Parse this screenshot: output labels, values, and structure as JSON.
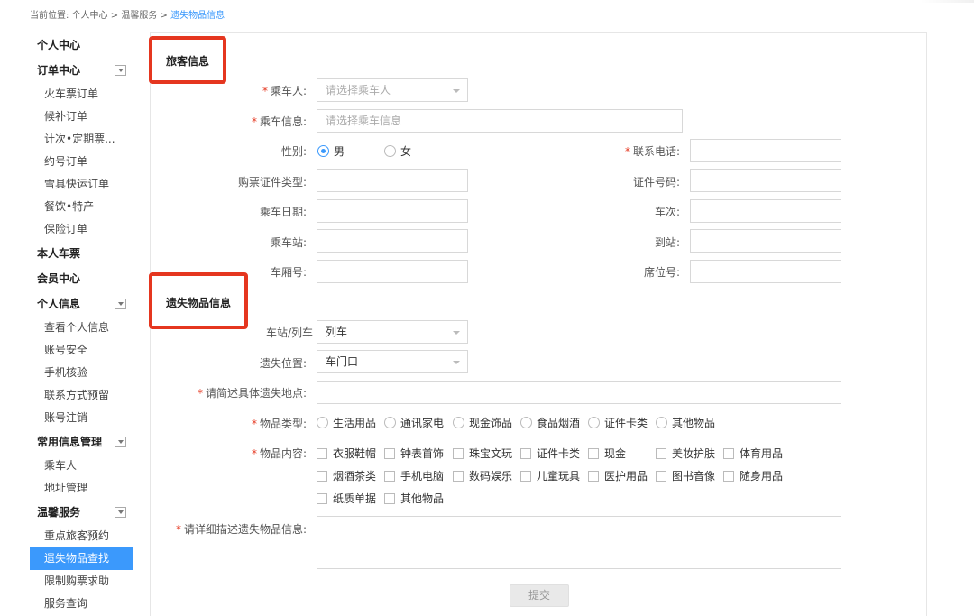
{
  "breadcrumb": {
    "prefix": "当前位置:",
    "items": [
      "个人中心",
      "温馨服务"
    ],
    "separator": ">",
    "current": "遗失物品信息"
  },
  "sidebar": {
    "groups": [
      {
        "label": "个人中心",
        "collapsible": false,
        "items": []
      },
      {
        "label": "订单中心",
        "collapsible": true,
        "items": [
          "火车票订单",
          "候补订单",
          "计次•定期票...",
          "约号订单",
          "雪具快运订单",
          "餐饮•特产",
          "保险订单"
        ]
      },
      {
        "label": "本人车票",
        "collapsible": false,
        "items": []
      },
      {
        "label": "会员中心",
        "collapsible": false,
        "items": []
      },
      {
        "label": "个人信息",
        "collapsible": true,
        "items": [
          "查看个人信息",
          "账号安全",
          "手机核验",
          "联系方式预留",
          "账号注销"
        ]
      },
      {
        "label": "常用信息管理",
        "collapsible": true,
        "items": [
          "乘车人",
          "地址管理"
        ]
      },
      {
        "label": "温馨服务",
        "collapsible": true,
        "items": [
          "重点旅客预约",
          "遗失物品查找",
          "限制购票求助",
          "服务查询"
        ]
      }
    ],
    "active_item": "遗失物品查找"
  },
  "passenger_section": {
    "title": "旅客信息",
    "passenger": {
      "label": "乘车人:",
      "placeholder": "请选择乘车人"
    },
    "passenger_info": {
      "label": "乘车信息:",
      "placeholder": "请选择乘车信息"
    },
    "gender": {
      "label": "性别:",
      "options": [
        "男",
        "女"
      ],
      "selected": "男"
    },
    "phone": {
      "label": "联系电话:",
      "value": ""
    },
    "id_type": {
      "label": "购票证件类型:",
      "value": ""
    },
    "id_number": {
      "label": "证件号码:",
      "value": ""
    },
    "date": {
      "label": "乘车日期:",
      "value": ""
    },
    "train_no": {
      "label": "车次:",
      "value": ""
    },
    "from_station": {
      "label": "乘车站:",
      "value": ""
    },
    "to_station": {
      "label": "到站:",
      "value": ""
    },
    "carriage": {
      "label": "车厢号:",
      "value": ""
    },
    "seat": {
      "label": "席位号:",
      "value": ""
    }
  },
  "lost_section": {
    "title": "遗失物品信息",
    "station_or_train": {
      "label": "车站/列车",
      "value": "列车"
    },
    "location": {
      "label": "遗失位置:",
      "value": "车门口"
    },
    "place_desc": {
      "label": "请简述具体遗失地点:",
      "value": ""
    },
    "item_type": {
      "label": "物品类型:",
      "options": [
        "生活用品",
        "通讯家电",
        "现金饰品",
        "食品烟酒",
        "证件卡类",
        "其他物品"
      ]
    },
    "item_content": {
      "label": "物品内容:",
      "options": [
        "衣服鞋帽",
        "钟表首饰",
        "珠宝文玩",
        "证件卡类",
        "现金",
        "美妆护肤",
        "体育用品",
        "烟酒茶类",
        "手机电脑",
        "数码娱乐",
        "儿童玩具",
        "医护用品",
        "图书音像",
        "随身用品",
        "纸质单据",
        "其他物品"
      ]
    },
    "detail_desc": {
      "label": "请详细描述遗失物品信息:",
      "value": ""
    },
    "submit_label": "提交"
  },
  "colors": {
    "accent": "#3b99fc",
    "highlight_box": "#e5361f",
    "required": "#e5361f"
  }
}
